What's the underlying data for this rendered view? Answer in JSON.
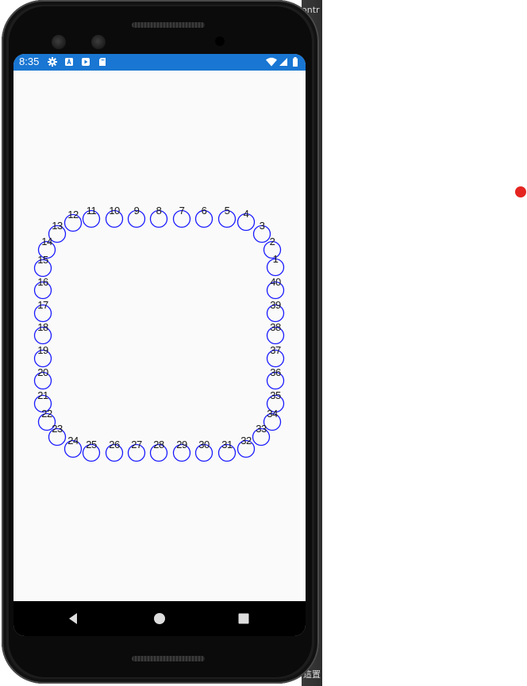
{
  "status_bar": {
    "time": "8:35"
  },
  "ring": {
    "labels": [
      "1",
      "2",
      "3",
      "4",
      "5",
      "6",
      "7",
      "8",
      "9",
      "10",
      "11",
      "12",
      "13",
      "14",
      "15",
      "16",
      "17",
      "18",
      "19",
      "20",
      "21",
      "22",
      "23",
      "24",
      "25",
      "26",
      "27",
      "28",
      "29",
      "30",
      "31",
      "32",
      "33",
      "34",
      "35",
      "36",
      "37",
      "38",
      "39",
      "40"
    ],
    "circle_color": "#1a1aff"
  },
  "background_window": {
    "text_top": "ontr",
    "text_bottom": "這置",
    "strip_color": "#2e2e2e"
  },
  "colors": {
    "status_bar": "#1976d2",
    "screen": "#fafafa",
    "red_indicator": "#e52420"
  },
  "icons": [
    "settings-icon",
    "a-icon",
    "play-store-icon",
    "sd-card-icon",
    "wifi-icon",
    "signal-icon",
    "battery-icon",
    "back-icon",
    "home-icon",
    "recents-icon"
  ]
}
